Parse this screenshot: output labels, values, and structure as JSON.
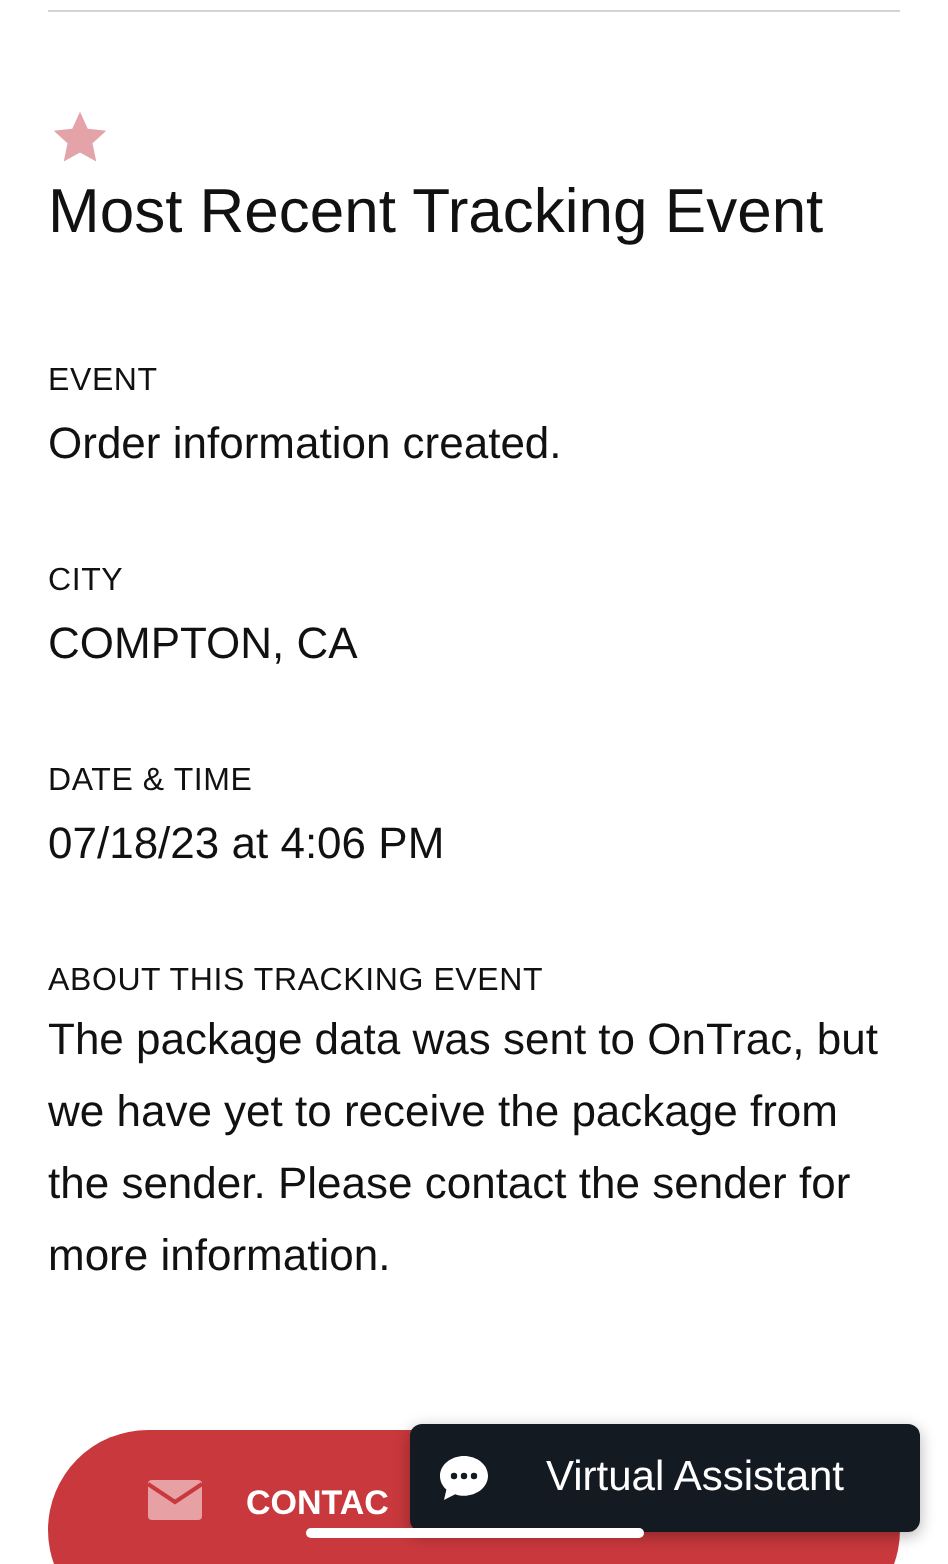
{
  "section": {
    "title": "Most Recent Tracking Event"
  },
  "fields": [
    {
      "label": "EVENT",
      "value": "Order information created."
    },
    {
      "label": "CITY",
      "value": "COMPTON, CA"
    },
    {
      "label": "DATE & TIME",
      "value": "07/18/23 at 4:06 PM"
    },
    {
      "label": "ABOUT THIS TRACKING EVENT",
      "value": "The package data was sent to OnTrac, but we have yet to receive the package from the sender. Please contact the sender for more information."
    }
  ],
  "contact_button": {
    "label": "CONTAC"
  },
  "assistant_button": {
    "label": "Virtual Assistant"
  }
}
